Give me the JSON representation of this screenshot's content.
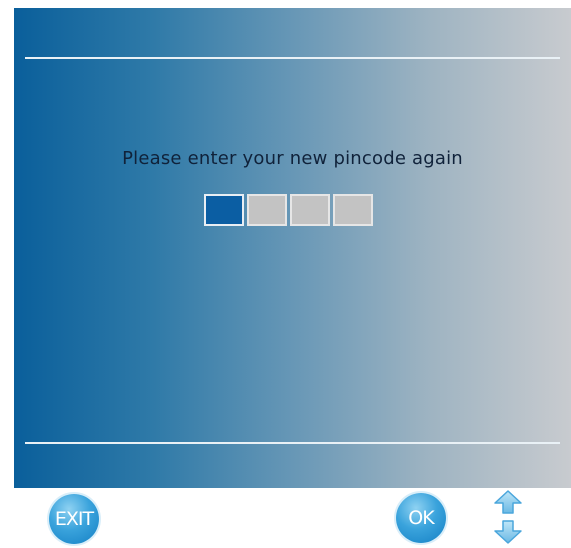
{
  "prompt": {
    "text": "Please enter your new pincode again"
  },
  "pin": {
    "length": 4,
    "active_index": 0
  },
  "buttons": {
    "exit_label": "EXIT",
    "ok_label": "OK"
  },
  "colors": {
    "gradient_start": "#0a5f9b",
    "gradient_end": "#c8cbcf",
    "pin_active": "#0b5ea3",
    "pin_inactive": "#c3c3c3",
    "button_blue": "#3aa3dc"
  },
  "icons": {
    "up": "arrow-up-icon",
    "down": "arrow-down-icon"
  }
}
